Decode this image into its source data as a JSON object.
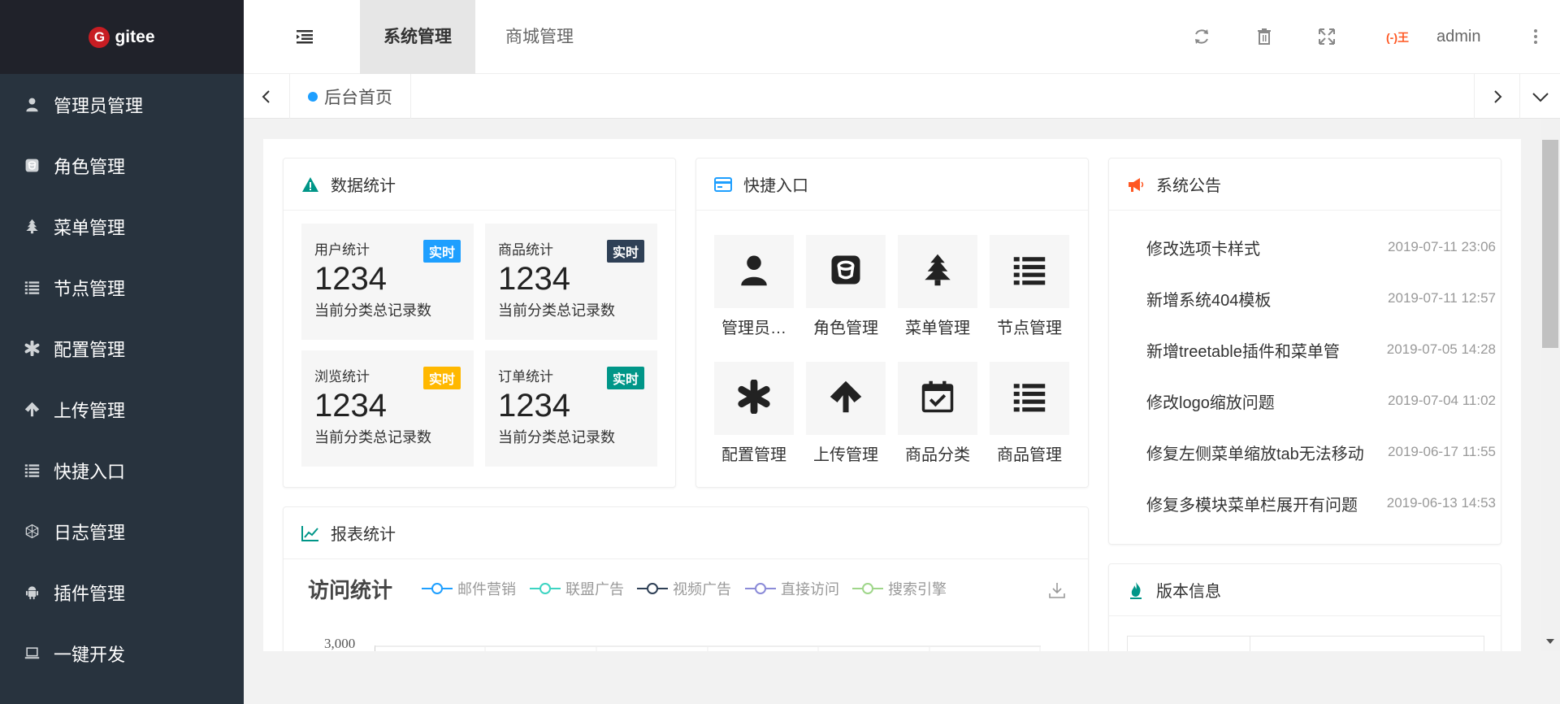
{
  "logo": {
    "mark": "G",
    "text": "gitee"
  },
  "sidebar": {
    "items": [
      {
        "label": "管理员管理",
        "icon": "user-icon"
      },
      {
        "label": "角色管理",
        "icon": "role-icon"
      },
      {
        "label": "菜单管理",
        "icon": "tree-icon"
      },
      {
        "label": "节点管理",
        "icon": "list-icon"
      },
      {
        "label": "配置管理",
        "icon": "asterisk-icon"
      },
      {
        "label": "上传管理",
        "icon": "arrow-up-icon"
      },
      {
        "label": "快捷入口",
        "icon": "list-icon"
      },
      {
        "label": "日志管理",
        "icon": "log-icon"
      },
      {
        "label": "插件管理",
        "icon": "android-icon"
      },
      {
        "label": "一键开发",
        "icon": "laptop-icon"
      }
    ]
  },
  "header": {
    "tabs": [
      "系统管理",
      "商城管理"
    ],
    "admin_badge": "(-)王",
    "admin_name": "admin"
  },
  "tabbar": {
    "home_tab": "后台首页"
  },
  "stats_card": {
    "title": "数据统计",
    "items": [
      {
        "title": "用户统计",
        "badge": "实时",
        "value": "1234",
        "desc": "当前分类总记录数",
        "badge_color": "#1e9fff"
      },
      {
        "title": "商品统计",
        "badge": "实时",
        "value": "1234",
        "desc": "当前分类总记录数",
        "badge_color": "#2f4056"
      },
      {
        "title": "浏览统计",
        "badge": "实时",
        "value": "1234",
        "desc": "当前分类总记录数",
        "badge_color": "#ffb800"
      },
      {
        "title": "订单统计",
        "badge": "实时",
        "value": "1234",
        "desc": "当前分类总记录数",
        "badge_color": "#009688"
      }
    ]
  },
  "quick_card": {
    "title": "快捷入口",
    "items": [
      {
        "label": "管理员…",
        "icon": "user-icon"
      },
      {
        "label": "角色管理",
        "icon": "role-icon"
      },
      {
        "label": "菜单管理",
        "icon": "tree-icon"
      },
      {
        "label": "节点管理",
        "icon": "list-icon"
      },
      {
        "label": "配置管理",
        "icon": "asterisk-icon"
      },
      {
        "label": "上传管理",
        "icon": "arrow-up-icon"
      },
      {
        "label": "商品分类",
        "icon": "calendar-check-icon"
      },
      {
        "label": "商品管理",
        "icon": "list-icon"
      }
    ]
  },
  "notice_card": {
    "title": "系统公告",
    "items": [
      {
        "title": "修改选项卡样式",
        "date": "2019-07-11 23:06"
      },
      {
        "title": "新增系统404模板",
        "date": "2019-07-11 12:57"
      },
      {
        "title": "新增treetable插件和菜单管",
        "date": "2019-07-05 14:28"
      },
      {
        "title": "修改logo缩放问题",
        "date": "2019-07-04 11:02"
      },
      {
        "title": "修复左侧菜单缩放tab无法移动",
        "date": "2019-06-17 11:55"
      },
      {
        "title": "修复多模块菜单栏展开有问题",
        "date": "2019-06-13 14:53"
      }
    ]
  },
  "version_card": {
    "title": "版本信息"
  },
  "report_card": {
    "title": "报表统计",
    "chart_title": "访问统计",
    "legend": [
      {
        "name": "邮件营销",
        "color": "#1e9fff"
      },
      {
        "name": "联盟广告",
        "color": "#3dd4c2"
      },
      {
        "name": "视频广告",
        "color": "#2f4056"
      },
      {
        "name": "直接访问",
        "color": "#8b8bd8"
      },
      {
        "name": "搜索引擎",
        "color": "#9fd68a"
      }
    ],
    "y_tick_top": "3,000"
  }
}
